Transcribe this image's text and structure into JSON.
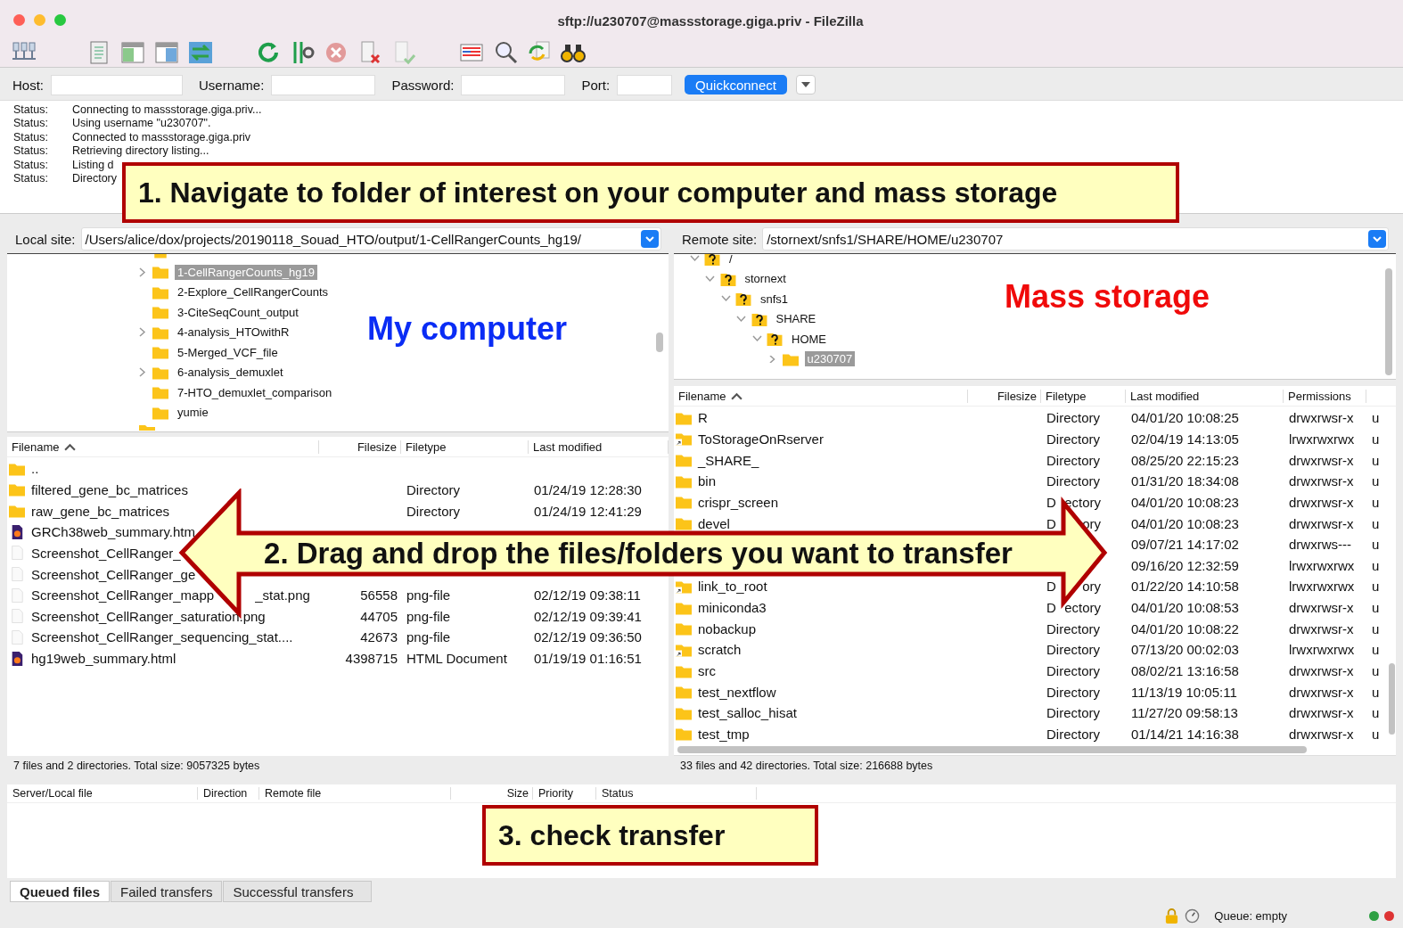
{
  "window": {
    "title": "sftp://u230707@massstorage.giga.priv - FileZilla"
  },
  "quickconnect": {
    "host_label": "Host:",
    "username_label": "Username:",
    "password_label": "Password:",
    "port_label": "Port:",
    "button": "Quickconnect"
  },
  "message_log": [
    {
      "label": "Status:",
      "text": "Connecting to massstorage.giga.priv..."
    },
    {
      "label": "Status:",
      "text": "Using username \"u230707\"."
    },
    {
      "label": "Status:",
      "text": "Connected to massstorage.giga.priv"
    },
    {
      "label": "Status:",
      "text": "Retrieving directory listing..."
    },
    {
      "label": "Status:",
      "text": "Listing d"
    },
    {
      "label": "Status:",
      "text": "Directory"
    }
  ],
  "local": {
    "site_label": "Local site:",
    "path": "/Users/alice/dox/projects/20190118_Souad_HTO/output/1-CellRangerCounts_hg19/",
    "tree": [
      {
        "label": "1-CellRangerCounts_hg19",
        "has_children": true,
        "selected": true
      },
      {
        "label": "2-Explore_CellRangerCounts",
        "has_children": false,
        "selected": false
      },
      {
        "label": "3-CiteSeqCount_output",
        "has_children": false,
        "selected": false
      },
      {
        "label": "4-analysis_HTOwithR",
        "has_children": true,
        "selected": false
      },
      {
        "label": "5-Merged_VCF_file",
        "has_children": false,
        "selected": false
      },
      {
        "label": "6-analysis_demuxlet",
        "has_children": true,
        "selected": false
      },
      {
        "label": "7-HTO_demuxlet_comparison",
        "has_children": false,
        "selected": false
      },
      {
        "label": "yumie",
        "has_children": false,
        "selected": false
      }
    ],
    "columns": [
      "Filename",
      "Filesize",
      "Filetype",
      "Last modified"
    ],
    "files": [
      {
        "kind": "folder",
        "name": ".."
      },
      {
        "kind": "folder",
        "name": "filtered_gene_bc_matrices",
        "type": "Directory",
        "modified": "01/24/19 12:28:30"
      },
      {
        "kind": "folder",
        "name": "raw_gene_bc_matrices",
        "type": "Directory",
        "modified": "01/24/19 12:41:29"
      },
      {
        "kind": "html",
        "name": "GRCh38web_summary.htm"
      },
      {
        "kind": "image",
        "name": "Screenshot_CellRanger_"
      },
      {
        "kind": "image",
        "name": "Screenshot_CellRanger_ge"
      },
      {
        "kind": "image",
        "name": "Screenshot_CellRanger_mapp",
        "name_end": "_stat.png",
        "size": "56558",
        "type": "png-file",
        "modified": "02/12/19 09:38:11"
      },
      {
        "kind": "image",
        "name": "Screenshot_CellRanger_saturation.png",
        "size": "44705",
        "type": "png-file",
        "modified": "02/12/19 09:39:41"
      },
      {
        "kind": "image",
        "name": "Screenshot_CellRanger_sequencing_stat....",
        "size": "42673",
        "type": "png-file",
        "modified": "02/12/19 09:36:50"
      },
      {
        "kind": "html",
        "name": "hg19web_summary.html",
        "size": "4398715",
        "type": "HTML Document",
        "modified": "01/19/19 01:16:51"
      }
    ],
    "status": "7 files and 2 directories. Total size: 9057325 bytes"
  },
  "remote": {
    "site_label": "Remote site:",
    "path": "/stornext/snfs1/SHARE/HOME/u230707",
    "tree": [
      {
        "label": "/",
        "expanded": true,
        "selected": false,
        "children": [
          {
            "label": "stornext",
            "expanded": true,
            "selected": false,
            "children": [
              {
                "label": "snfs1",
                "expanded": true,
                "selected": false,
                "children": [
                  {
                    "label": "SHARE",
                    "expanded": true,
                    "selected": false,
                    "children": [
                      {
                        "label": "HOME",
                        "expanded": true,
                        "selected": false,
                        "children": [
                          {
                            "label": "u230707",
                            "expanded": false,
                            "selected": true,
                            "kind": "folder"
                          }
                        ]
                      }
                    ]
                  }
                ]
              }
            ]
          }
        ]
      }
    ],
    "columns": [
      "Filename",
      "Filesize",
      "Filetype",
      "Last modified",
      "Permissions"
    ],
    "files": [
      {
        "kind": "folder",
        "name": "R",
        "type": "Directory",
        "modified": "04/01/20 10:08:25",
        "permissions": "drwxrwsr-x",
        "column_6": "u"
      },
      {
        "kind": "link",
        "name": "ToStorageOnRserver",
        "type": "Directory",
        "modified": "02/04/19 14:13:05",
        "permissions": "lrwxrwxrwx",
        "column_6": "u"
      },
      {
        "kind": "folder",
        "name": "_SHARE_",
        "type": "Directory",
        "modified": "08/25/20 22:15:23",
        "permissions": "drwxrwsr-x",
        "column_6": "u"
      },
      {
        "kind": "folder",
        "name": "bin",
        "type": "Directory",
        "modified": "01/31/20 18:34:08",
        "permissions": "drwxrwsr-x",
        "column_6": "u"
      },
      {
        "kind": "folder",
        "name": "crispr_screen",
        "type_parts": [
          "D",
          "ectory"
        ],
        "modified": "04/01/20 10:08:23",
        "permissions": "drwxrwsr-x",
        "column_6": "u"
      },
      {
        "kind": "folder",
        "name": "devel",
        "type_parts": [
          "D",
          "ory"
        ],
        "modified": "04/01/20 10:08:23",
        "permissions": "drwxrwsr-x",
        "column_6": "u"
      },
      {
        "modified": "09/07/21 14:17:02",
        "permissions": "drwxrws---",
        "column_6": "u"
      },
      {
        "modified": "09/16/20 12:32:59",
        "permissions": "lrwxrwxrwx",
        "column_6": "u"
      },
      {
        "kind": "link",
        "name": "link_to_root",
        "type_parts": [
          "D",
          "ory"
        ],
        "modified": "01/22/20 14:10:58",
        "permissions": "lrwxrwxrwx",
        "column_6": "u"
      },
      {
        "kind": "folder",
        "name": "miniconda3",
        "type_parts": [
          "D",
          "ectory"
        ],
        "modified": "04/01/20 10:08:53",
        "permissions": "drwxrwsr-x",
        "column_6": "u"
      },
      {
        "kind": "folder",
        "name": "nobackup",
        "type": "Directory",
        "modified": "04/01/20 10:08:22",
        "permissions": "drwxrwsr-x",
        "column_6": "u"
      },
      {
        "kind": "link",
        "name": "scratch",
        "type": "Directory",
        "modified": "07/13/20 00:02:03",
        "permissions": "lrwxrwxrwx",
        "column_6": "u"
      },
      {
        "kind": "folder",
        "name": "src",
        "type": "Directory",
        "modified": "08/02/21 13:16:58",
        "permissions": "drwxrwsr-x",
        "column_6": "u"
      },
      {
        "kind": "folder",
        "name": "test_nextflow",
        "type": "Directory",
        "modified": "11/13/19 10:05:11",
        "permissions": "drwxrwsr-x",
        "column_6": "u"
      },
      {
        "kind": "folder",
        "name": "test_salloc_hisat",
        "type": "Directory",
        "modified": "11/27/20 09:58:13",
        "permissions": "drwxrwsr-x",
        "column_6": "u"
      },
      {
        "kind": "folder",
        "name": "test_tmp",
        "type": "Directory",
        "modified": "01/14/21 14:16:38",
        "permissions": "drwxrwsr-x",
        "column_6": "u"
      }
    ],
    "status": "33 files and 42 directories. Total size: 216688 bytes"
  },
  "queue": {
    "columns": [
      "Server/Local file",
      "Direction",
      "Remote file",
      "Size",
      "Priority",
      "Status"
    ],
    "tabs": [
      {
        "label": "Queued files",
        "selected": true
      },
      {
        "label": "Failed transfers",
        "selected": false
      },
      {
        "label": "Successful transfers",
        "selected": false
      }
    ],
    "status": "Queue: empty"
  },
  "annotations": [
    {
      "kind": "box",
      "text": "1. Navigate to folder of interest on your computer and mass storage"
    },
    {
      "kind": "arrow",
      "text": "2. Drag and drop the files/folders you want to transfer"
    },
    {
      "kind": "box",
      "text": "3. check transfer"
    },
    {
      "kind": "label",
      "text": "My computer",
      "color": "#0a2cf5"
    },
    {
      "kind": "label",
      "text": "Mass storage",
      "color": "#f00a0a"
    }
  ]
}
